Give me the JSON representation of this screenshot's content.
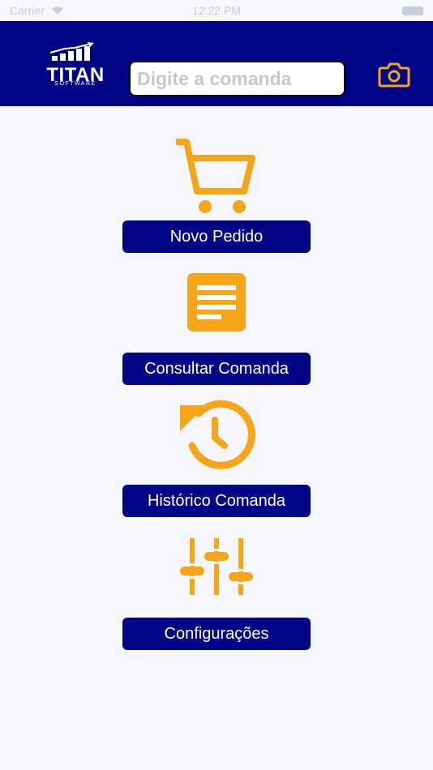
{
  "status_bar": {
    "carrier": "Carrier",
    "time": "12:22 PM"
  },
  "header": {
    "logo_title": "TITAN",
    "logo_subtitle": "SOFTWARE",
    "search_placeholder": "Digite a comanda",
    "camera_icon": "camera-icon"
  },
  "colors": {
    "header_bg": "#020686",
    "accent": "#F5A515",
    "background": "#F5F7FC",
    "button_text": "#FFFFFF"
  },
  "menu": [
    {
      "icon": "cart-icon",
      "label": "Novo Pedido"
    },
    {
      "icon": "document-icon",
      "label": "Consultar Comanda"
    },
    {
      "icon": "history-icon",
      "label": "Histórico Comanda"
    },
    {
      "icon": "sliders-icon",
      "label": "Configurações"
    }
  ]
}
